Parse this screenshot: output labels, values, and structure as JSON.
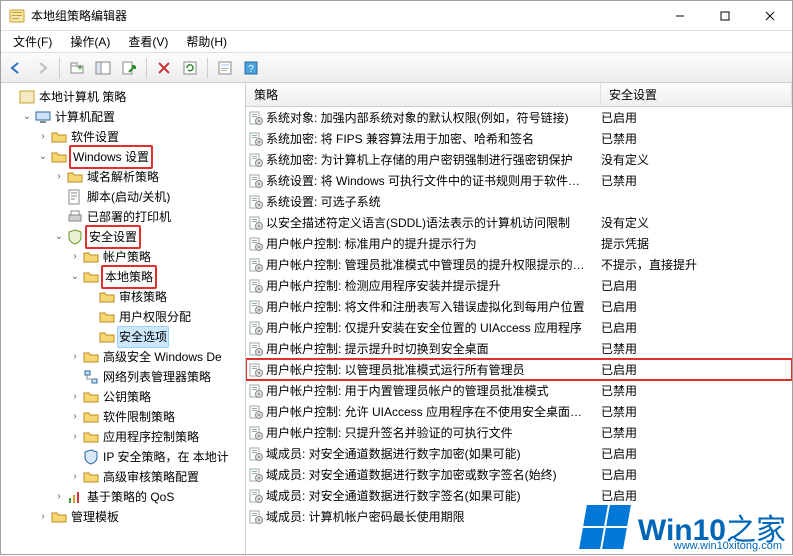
{
  "window": {
    "title": "本地组策略编辑器"
  },
  "menu": {
    "file": "文件(F)",
    "action": "操作(A)",
    "view": "查看(V)",
    "help": "帮助(H)"
  },
  "toolbar": {
    "back": "back",
    "forward": "forward",
    "up": "up",
    "show_hide": "show-hide",
    "export": "export",
    "delete": "remove",
    "refresh": "refresh",
    "properties": "properties",
    "help": "help"
  },
  "tree": {
    "root": "本地计算机 策略",
    "computer_config": "计算机配置",
    "software_settings": "软件设置",
    "windows_settings": "Windows 设置",
    "name_resolution": "域名解析策略",
    "scripts": "脚本(启动/关机)",
    "deployed_printers": "已部署的打印机",
    "security_settings": "安全设置",
    "account_policies": "帐户策略",
    "local_policies": "本地策略",
    "audit_policy": "审核策略",
    "user_rights": "用户权限分配",
    "security_options": "安全选项",
    "advanced_windows_defender": "高级安全 Windows De",
    "network_list": "网络列表管理器策略",
    "public_key": "公钥策略",
    "software_restriction": "软件限制策略",
    "app_control": "应用程序控制策略",
    "ip_security": "IP 安全策略，在 本地计",
    "advanced_audit": "高级审核策略配置",
    "policy_qos": "基于策略的 QoS",
    "admin_templates": "管理模板"
  },
  "list_headers": {
    "policy": "策略",
    "setting": "安全设置"
  },
  "rows": [
    {
      "policy": "系统对象: 加强内部系统对象的默认权限(例如，符号链接)",
      "setting": "已启用"
    },
    {
      "policy": "系统加密: 将 FIPS 兼容算法用于加密、哈希和签名",
      "setting": "已禁用"
    },
    {
      "policy": "系统加密: 为计算机上存储的用户密钥强制进行强密钥保护",
      "setting": "没有定义"
    },
    {
      "policy": "系统设置: 将 Windows 可执行文件中的证书规则用于软件…",
      "setting": "已禁用"
    },
    {
      "policy": "系统设置: 可选子系统",
      "setting": ""
    },
    {
      "policy": "以安全描述符定义语言(SDDL)语法表示的计算机访问限制",
      "setting": "没有定义"
    },
    {
      "policy": "用户帐户控制: 标准用户的提升提示行为",
      "setting": "提示凭据"
    },
    {
      "policy": "用户帐户控制: 管理员批准模式中管理员的提升权限提示的…",
      "setting": "不提示，直接提升"
    },
    {
      "policy": "用户帐户控制: 检测应用程序安装并提示提升",
      "setting": "已启用"
    },
    {
      "policy": "用户帐户控制: 将文件和注册表写入错误虚拟化到每用户位置",
      "setting": "已启用"
    },
    {
      "policy": "用户帐户控制: 仅提升安装在安全位置的 UIAccess 应用程序",
      "setting": "已启用"
    },
    {
      "policy": "用户帐户控制: 提示提升时切换到安全桌面",
      "setting": "已禁用"
    },
    {
      "policy": "用户帐户控制: 以管理员批准模式运行所有管理员",
      "setting": "已启用",
      "highlight": true
    },
    {
      "policy": "用户帐户控制: 用于内置管理员帐户的管理员批准模式",
      "setting": "已禁用"
    },
    {
      "policy": "用户帐户控制: 允许 UIAccess 应用程序在不使用安全桌面…",
      "setting": "已禁用"
    },
    {
      "policy": "用户帐户控制: 只提升签名并验证的可执行文件",
      "setting": "已禁用"
    },
    {
      "policy": "域成员: 对安全通道数据进行数字加密(如果可能)",
      "setting": "已启用"
    },
    {
      "policy": "域成员: 对安全通道数据进行数字加密或数字签名(始终)",
      "setting": "已启用"
    },
    {
      "policy": "域成员: 对安全通道数据进行数字签名(如果可能)",
      "setting": "已启用"
    },
    {
      "policy": "域成员: 计算机帐户密码最长使用期限",
      "setting": ""
    }
  ],
  "watermark": {
    "brand_main": "Win10",
    "brand_sub": "之家",
    "url": "www.win10xitong.com"
  }
}
